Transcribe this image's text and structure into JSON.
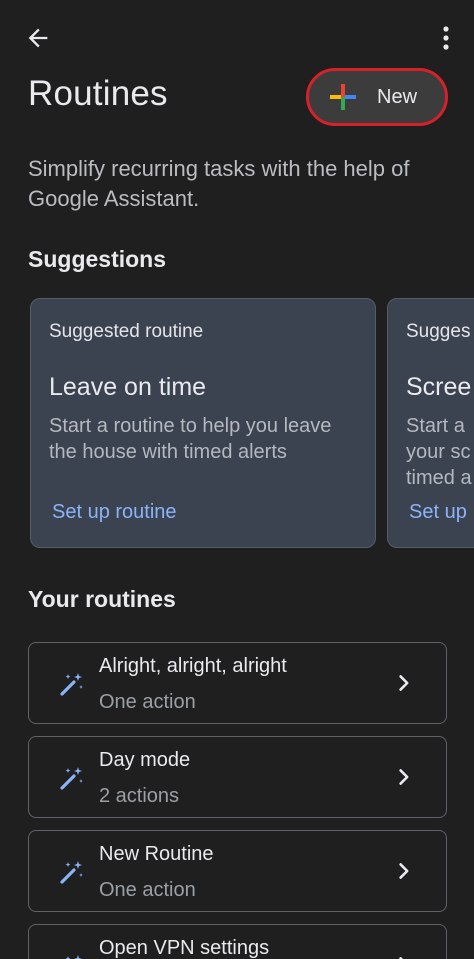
{
  "header": {
    "title": "Routines",
    "new_button_label": "New"
  },
  "intro": "Simplify recurring tasks with the help of Google Assistant.",
  "suggestions": {
    "heading": "Suggestions",
    "cards": [
      {
        "kicker": "Suggested routine",
        "title": "Leave on time",
        "description": "Start a routine to help you leave the house with timed alerts",
        "cta": "Set up routine"
      },
      {
        "kicker": "Sugges",
        "title": "Scree",
        "description": "Start a your sc timed a",
        "cta": "Set up"
      }
    ]
  },
  "your_routines": {
    "heading": "Your routines",
    "items": [
      {
        "name": "Alright, alright, alright",
        "count": "One action"
      },
      {
        "name": "Day mode",
        "count": "2 actions"
      },
      {
        "name": "New Routine",
        "count": "One action"
      },
      {
        "name": "Open VPN settings",
        "count": ""
      }
    ]
  },
  "colors": {
    "background": "#1f1f1f",
    "card": "#3c4350",
    "link": "#8ab4f8",
    "highlight_ring": "#d5222a",
    "wand_icon": "#8ab4f8"
  },
  "icons": [
    "back-arrow-icon",
    "more-vert-icon",
    "google-plus-icon",
    "magic-wand-icon",
    "chevron-right-icon"
  ]
}
